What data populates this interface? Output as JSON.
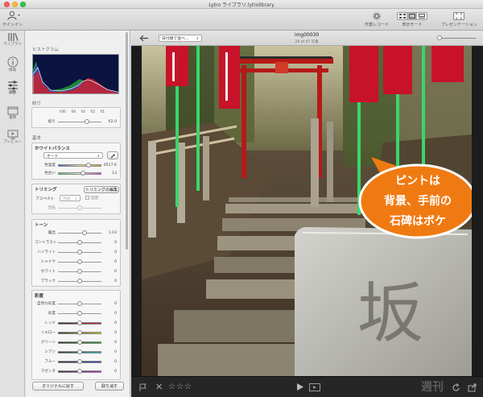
{
  "window": {
    "title": "Lytro ライブラリ.lytrolibrary"
  },
  "toolbar": {
    "signin": "サインイン",
    "record": "作業レコード",
    "display_mode": "表示モード",
    "presentation": "プレゼンテーション"
  },
  "rail": {
    "items": [
      {
        "label": "ライブラリ",
        "icon": "library-icon"
      },
      {
        "label": "情報",
        "icon": "info-icon"
      },
      {
        "label": "調整",
        "icon": "adjust-sliders-icon"
      },
      {
        "label": "書類",
        "icon": "folder-icon"
      },
      {
        "label": "プレビュー",
        "icon": "preview-icon"
      }
    ]
  },
  "panel": {
    "histogram_title": "ヒストグラム",
    "aperture": {
      "title": "絞り",
      "scale": [
        "f/36",
        "f/8",
        "f/4",
        "f/2",
        "f/1"
      ],
      "label": "絞り",
      "value": "f/2.0",
      "level": 0.66
    },
    "basic_title": "基本",
    "white_balance": {
      "title": "ホワイトバランス",
      "preset": "オート",
      "rows": [
        {
          "name": "色温度",
          "value": "6517 K",
          "level": 0.72
        },
        {
          "name": "色合い",
          "value": "13",
          "level": 0.58
        }
      ]
    },
    "trimming": {
      "title": "トリミング",
      "edit_button": "トリミングの編集",
      "aspect_label": "アスペクト",
      "aspect_value": "元の",
      "lock_label": "固定",
      "rotate_label": "回転"
    },
    "tone": {
      "title": "トーン",
      "rows": [
        {
          "name": "露出",
          "value": "1.03",
          "level": 0.62
        },
        {
          "name": "コントラスト",
          "value": "0",
          "level": 0.5
        },
        {
          "name": "ハイライト",
          "value": "0",
          "level": 0.5
        },
        {
          "name": "シャドウ",
          "value": "0",
          "level": 0.5
        },
        {
          "name": "ホワイト",
          "value": "0",
          "level": 0.5
        },
        {
          "name": "ブラック",
          "value": "0",
          "level": 0.5
        }
      ]
    },
    "saturation": {
      "title": "彩度",
      "rows": [
        {
          "name": "自然な彩度",
          "value": "0",
          "level": 0.5
        },
        {
          "name": "彩度",
          "value": "0",
          "level": 0.5
        },
        {
          "name": "レッド",
          "value": "0",
          "level": 0.5,
          "color": "#d82020"
        },
        {
          "name": "イエロー",
          "value": "0",
          "level": 0.5,
          "color": "#d9c21a"
        },
        {
          "name": "グリーン",
          "value": "0",
          "level": 0.5,
          "color": "#2aa02a"
        },
        {
          "name": "シアン",
          "value": "0",
          "level": 0.5,
          "color": "#20b6c8"
        },
        {
          "name": "ブルー",
          "value": "0",
          "level": 0.5,
          "color": "#2448d0"
        },
        {
          "name": "マゼンタ",
          "value": "0",
          "level": 0.5,
          "color": "#c42bc4"
        }
      ]
    },
    "reset_button": "オリジナルに戻す",
    "cancel_button": "取り消す"
  },
  "viewer": {
    "sort": "日付順で並べ…",
    "image_name": "img00030",
    "image_position": "29 of 47 写真"
  },
  "annotation": {
    "line1": "ピントは",
    "line2": "背景、手前の",
    "line3": "石碑はボケ"
  },
  "stone_carving": "坂",
  "watermark": "週刊",
  "colors": {
    "accent": "#f07a12",
    "torii": "#c8201e"
  }
}
